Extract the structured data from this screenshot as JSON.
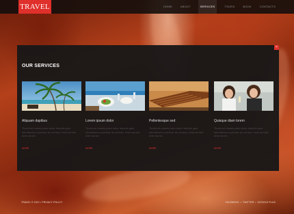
{
  "brand": {
    "logo": "TRAVEL"
  },
  "nav": {
    "items": [
      "HOME",
      "ABOUT",
      "SERVICES",
      "TOURS",
      "BOOK",
      "CONTACTS"
    ],
    "active": "SERVICES"
  },
  "panel": {
    "title": "OUR SERVICES",
    "close": "×",
    "cards": [
      {
        "title": "Aliquam dapibus",
        "text": "Tincidunt mauris justo dolor lobortis quis lobortisnunc pulvinar ac consec- tetul uemed ante donec",
        "more": "MORE",
        "image": "palm-beach"
      },
      {
        "title": "Lorem ipsum dolor",
        "text": "Tincidunt mauris justo dolor lobortis quis lobortisnunc pulvinar ac consec- tetul uemed ante donec",
        "more": "MORE",
        "image": "restaurant-table"
      },
      {
        "title": "Pellentesque sed",
        "text": "Tincidunt mauris justo dolor lobortis quis lobortisnunc pulvinar ac consec- tetul uemed ante donec",
        "more": "MORE",
        "image": "deck-chairs"
      },
      {
        "title": "Quisque diam lorem",
        "text": "Tincidunt mauris justo dolor lobortis quis lobortisnunc pulvinar ac consec- tetul uemed ante donec",
        "more": "MORE",
        "image": "women-drinks"
      }
    ]
  },
  "footer": {
    "copyright": "TRAVEL © 2012 • PRIVACY POLICY",
    "social": [
      "FACEBOOK",
      "TWITTER",
      "GOOGLE PLUS"
    ],
    "separator": "•"
  },
  "colors": {
    "accent": "#e0302b",
    "panel": "#1a1818",
    "topbar": "#140e0c"
  }
}
